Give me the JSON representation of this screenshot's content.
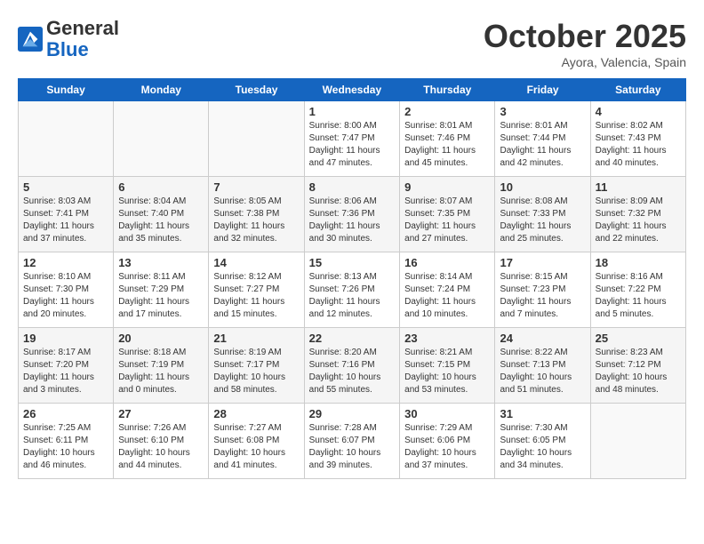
{
  "header": {
    "logo_general": "General",
    "logo_blue": "Blue",
    "month": "October 2025",
    "location": "Ayora, Valencia, Spain"
  },
  "days_of_week": [
    "Sunday",
    "Monday",
    "Tuesday",
    "Wednesday",
    "Thursday",
    "Friday",
    "Saturday"
  ],
  "weeks": [
    [
      {
        "num": "",
        "info": ""
      },
      {
        "num": "",
        "info": ""
      },
      {
        "num": "",
        "info": ""
      },
      {
        "num": "1",
        "info": "Sunrise: 8:00 AM\nSunset: 7:47 PM\nDaylight: 11 hours and 47 minutes."
      },
      {
        "num": "2",
        "info": "Sunrise: 8:01 AM\nSunset: 7:46 PM\nDaylight: 11 hours and 45 minutes."
      },
      {
        "num": "3",
        "info": "Sunrise: 8:01 AM\nSunset: 7:44 PM\nDaylight: 11 hours and 42 minutes."
      },
      {
        "num": "4",
        "info": "Sunrise: 8:02 AM\nSunset: 7:43 PM\nDaylight: 11 hours and 40 minutes."
      }
    ],
    [
      {
        "num": "5",
        "info": "Sunrise: 8:03 AM\nSunset: 7:41 PM\nDaylight: 11 hours and 37 minutes."
      },
      {
        "num": "6",
        "info": "Sunrise: 8:04 AM\nSunset: 7:40 PM\nDaylight: 11 hours and 35 minutes."
      },
      {
        "num": "7",
        "info": "Sunrise: 8:05 AM\nSunset: 7:38 PM\nDaylight: 11 hours and 32 minutes."
      },
      {
        "num": "8",
        "info": "Sunrise: 8:06 AM\nSunset: 7:36 PM\nDaylight: 11 hours and 30 minutes."
      },
      {
        "num": "9",
        "info": "Sunrise: 8:07 AM\nSunset: 7:35 PM\nDaylight: 11 hours and 27 minutes."
      },
      {
        "num": "10",
        "info": "Sunrise: 8:08 AM\nSunset: 7:33 PM\nDaylight: 11 hours and 25 minutes."
      },
      {
        "num": "11",
        "info": "Sunrise: 8:09 AM\nSunset: 7:32 PM\nDaylight: 11 hours and 22 minutes."
      }
    ],
    [
      {
        "num": "12",
        "info": "Sunrise: 8:10 AM\nSunset: 7:30 PM\nDaylight: 11 hours and 20 minutes."
      },
      {
        "num": "13",
        "info": "Sunrise: 8:11 AM\nSunset: 7:29 PM\nDaylight: 11 hours and 17 minutes."
      },
      {
        "num": "14",
        "info": "Sunrise: 8:12 AM\nSunset: 7:27 PM\nDaylight: 11 hours and 15 minutes."
      },
      {
        "num": "15",
        "info": "Sunrise: 8:13 AM\nSunset: 7:26 PM\nDaylight: 11 hours and 12 minutes."
      },
      {
        "num": "16",
        "info": "Sunrise: 8:14 AM\nSunset: 7:24 PM\nDaylight: 11 hours and 10 minutes."
      },
      {
        "num": "17",
        "info": "Sunrise: 8:15 AM\nSunset: 7:23 PM\nDaylight: 11 hours and 7 minutes."
      },
      {
        "num": "18",
        "info": "Sunrise: 8:16 AM\nSunset: 7:22 PM\nDaylight: 11 hours and 5 minutes."
      }
    ],
    [
      {
        "num": "19",
        "info": "Sunrise: 8:17 AM\nSunset: 7:20 PM\nDaylight: 11 hours and 3 minutes."
      },
      {
        "num": "20",
        "info": "Sunrise: 8:18 AM\nSunset: 7:19 PM\nDaylight: 11 hours and 0 minutes."
      },
      {
        "num": "21",
        "info": "Sunrise: 8:19 AM\nSunset: 7:17 PM\nDaylight: 10 hours and 58 minutes."
      },
      {
        "num": "22",
        "info": "Sunrise: 8:20 AM\nSunset: 7:16 PM\nDaylight: 10 hours and 55 minutes."
      },
      {
        "num": "23",
        "info": "Sunrise: 8:21 AM\nSunset: 7:15 PM\nDaylight: 10 hours and 53 minutes."
      },
      {
        "num": "24",
        "info": "Sunrise: 8:22 AM\nSunset: 7:13 PM\nDaylight: 10 hours and 51 minutes."
      },
      {
        "num": "25",
        "info": "Sunrise: 8:23 AM\nSunset: 7:12 PM\nDaylight: 10 hours and 48 minutes."
      }
    ],
    [
      {
        "num": "26",
        "info": "Sunrise: 7:25 AM\nSunset: 6:11 PM\nDaylight: 10 hours and 46 minutes."
      },
      {
        "num": "27",
        "info": "Sunrise: 7:26 AM\nSunset: 6:10 PM\nDaylight: 10 hours and 44 minutes."
      },
      {
        "num": "28",
        "info": "Sunrise: 7:27 AM\nSunset: 6:08 PM\nDaylight: 10 hours and 41 minutes."
      },
      {
        "num": "29",
        "info": "Sunrise: 7:28 AM\nSunset: 6:07 PM\nDaylight: 10 hours and 39 minutes."
      },
      {
        "num": "30",
        "info": "Sunrise: 7:29 AM\nSunset: 6:06 PM\nDaylight: 10 hours and 37 minutes."
      },
      {
        "num": "31",
        "info": "Sunrise: 7:30 AM\nSunset: 6:05 PM\nDaylight: 10 hours and 34 minutes."
      },
      {
        "num": "",
        "info": ""
      }
    ]
  ]
}
